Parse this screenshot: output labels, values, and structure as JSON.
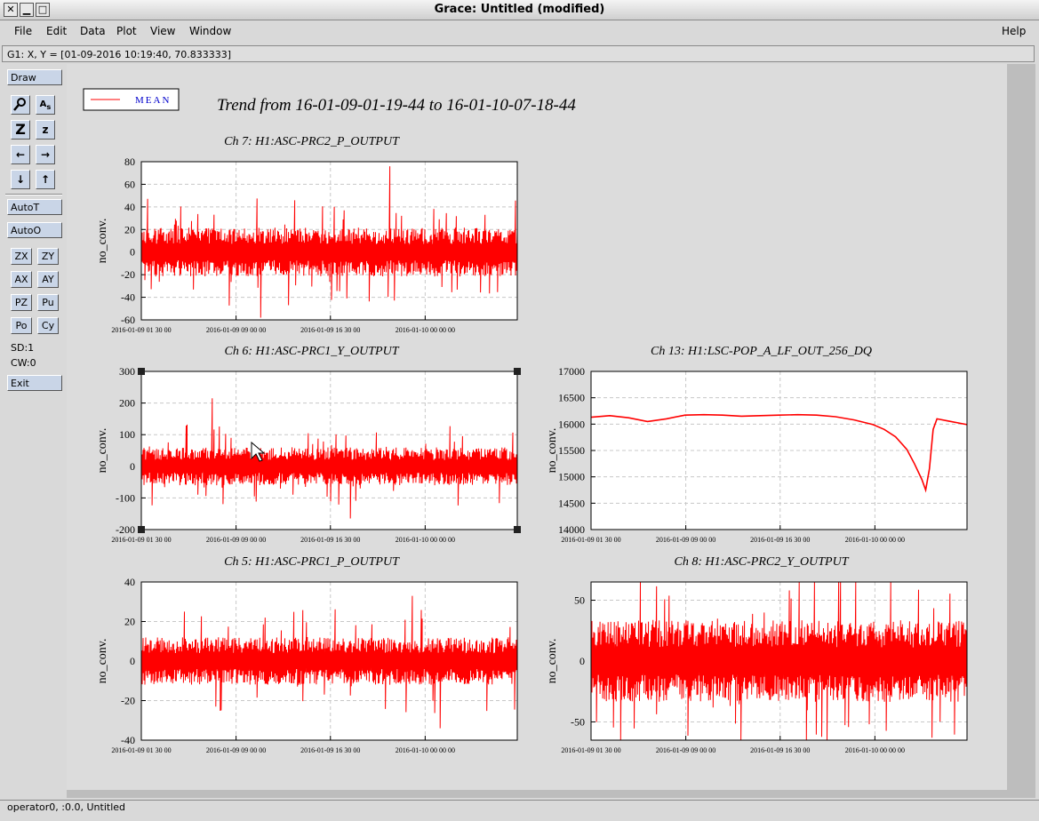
{
  "window": {
    "title": "Grace: Untitled (modified)",
    "close_glyph": "✕",
    "min_glyph": "▁",
    "max_glyph": "□"
  },
  "menubar": {
    "file": "File",
    "edit": "Edit",
    "data": "Data",
    "plot": "Plot",
    "view": "View",
    "window": "Window",
    "help": "Help"
  },
  "locator": "G1: X, Y = [01-09-2016 10:19:40, 70.833333]",
  "toolbar": {
    "draw": "Draw",
    "autot": "AutoT",
    "autoo": "AutoO",
    "zx": "ZX",
    "zy": "ZY",
    "ax": "AX",
    "ay": "AY",
    "pz": "PZ",
    "pu": "Pu",
    "po": "Po",
    "cy": "Cy",
    "sd": "SD:1",
    "cw": "CW:0",
    "exit": "Exit",
    "icons": [
      "magnifier-icon",
      "autoscale-text-icon",
      "zoom-icon",
      "z-icon",
      "arrow-left-icon",
      "arrow-right-icon",
      "arrow-down-icon",
      "arrow-up-icon"
    ]
  },
  "status": "operator0, :0.0, Untitled",
  "legend": {
    "label": "MEAN",
    "color": "#ff0000"
  },
  "plot_title": "Trend from 16-01-09-01-19-44 to 16-01-10-07-18-44",
  "colors": {
    "trace": "#ff0000",
    "grid": "#c8c8c8"
  },
  "chart_data": [
    {
      "type": "line",
      "title": "Ch 7: H1:ASC-PRC2_P_OUTPUT",
      "ylabel": "no_conv.",
      "ylim": [
        -60,
        80
      ],
      "yticks": [
        -60,
        -40,
        -20,
        0,
        20,
        40,
        60,
        80
      ],
      "xticks": [
        "2016-01-09 01 30 00",
        "2016-01-09 09 00 00",
        "2016-01-09 16 30 00",
        "2016-01-10 00 00 00"
      ],
      "series": [
        {
          "name": "MEAN",
          "kind": "noise",
          "center": 0,
          "typical_amp": 18,
          "max": 76,
          "min": -58,
          "seed": 7
        }
      ]
    },
    {
      "type": "line",
      "title": "Ch 6: H1:ASC-PRC1_Y_OUTPUT",
      "ylabel": "no_conv.",
      "ylim": [
        -200,
        300
      ],
      "yticks": [
        -200,
        -100,
        0,
        100,
        200,
        300
      ],
      "xticks": [
        "2016-01-09 01 30 00",
        "2016-01-09 09 00 00",
        "2016-01-09 16 30 00",
        "2016-01-10 00 00 00"
      ],
      "series": [
        {
          "name": "MEAN",
          "kind": "noise",
          "center": 0,
          "typical_amp": 50,
          "max": 215,
          "min": -165,
          "seed": 6
        }
      ]
    },
    {
      "type": "line",
      "title": "Ch 13: H1:LSC-POP_A_LF_OUT_256_DQ",
      "ylabel": "no_conv.",
      "ylim": [
        14000,
        17000
      ],
      "yticks": [
        14000,
        14500,
        15000,
        15500,
        16000,
        16500,
        17000
      ],
      "xticks": [
        "2016-01-09 01 30 00",
        "2016-01-09 09 00 00",
        "2016-01-09 16 30 00",
        "2016-01-10 00 00 00"
      ],
      "series": [
        {
          "name": "MEAN",
          "kind": "smooth",
          "x": [
            0,
            0.05,
            0.1,
            0.15,
            0.2,
            0.25,
            0.3,
            0.35,
            0.4,
            0.45,
            0.5,
            0.55,
            0.6,
            0.65,
            0.7,
            0.75,
            0.78,
            0.81,
            0.84,
            0.86,
            0.88,
            0.89,
            0.9,
            0.91,
            0.92,
            0.95,
            1.0
          ],
          "y": [
            16130,
            16160,
            16120,
            16050,
            16100,
            16170,
            16180,
            16170,
            16150,
            16160,
            16170,
            16180,
            16170,
            16140,
            16080,
            15990,
            15900,
            15760,
            15520,
            15250,
            14950,
            14750,
            15150,
            15900,
            16100,
            16060,
            15990
          ]
        }
      ]
    },
    {
      "type": "line",
      "title": "Ch 5: H1:ASC-PRC1_P_OUTPUT",
      "ylabel": "no_conv.",
      "ylim": [
        -40,
        40
      ],
      "yticks": [
        -40,
        -20,
        0,
        20,
        40
      ],
      "xticks": [
        "2016-01-09 01 30 00",
        "2016-01-09 09 00 00",
        "2016-01-09 16 30 00",
        "2016-01-10 00 00 00"
      ],
      "series": [
        {
          "name": "MEAN",
          "kind": "noise",
          "center": 0,
          "typical_amp": 10,
          "max": 33,
          "min": -34,
          "seed": 5
        }
      ]
    },
    {
      "type": "line",
      "title": "Ch 8: H1:ASC-PRC2_Y_OUTPUT",
      "ylabel": "no_conv.",
      "ylim": [
        -65,
        65
      ],
      "yticks": [
        -50,
        0,
        50
      ],
      "xticks": [
        "2016-01-09 01 30 00",
        "2016-01-09 09 00 00",
        "2016-01-09 16 30 00",
        "2016-01-10 00 00 00"
      ],
      "series": [
        {
          "name": "MEAN",
          "kind": "noise",
          "center": 0,
          "typical_amp": 28,
          "max": 65,
          "min": -65,
          "seed": 8
        }
      ]
    }
  ]
}
